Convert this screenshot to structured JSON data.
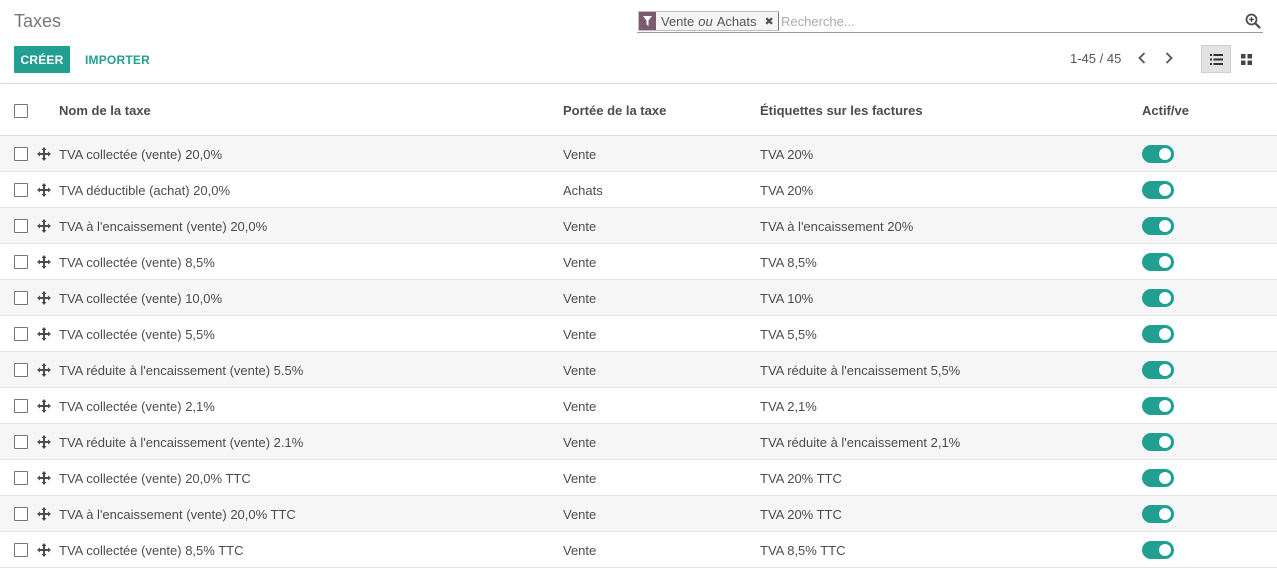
{
  "header": {
    "title": "Taxes",
    "create_label": "CRÉER",
    "import_label": "IMPORTER"
  },
  "search": {
    "facet_value_1": "Vente",
    "facet_separator": "ou",
    "facet_value_2": "Achats",
    "placeholder": "Recherche..."
  },
  "pager": {
    "range": "1-45 / 45"
  },
  "colors": {
    "primary": "#21a092",
    "facet_icon": "#7c5a70"
  },
  "columns": {
    "name": "Nom de la taxe",
    "scope": "Portée de la taxe",
    "tags": "Étiquettes sur les factures",
    "active": "Actif/ve"
  },
  "rows": [
    {
      "name": "TVA collectée (vente) 20,0%",
      "scope": "Vente",
      "tags": "TVA 20%",
      "active": true
    },
    {
      "name": "TVA déductible (achat) 20,0%",
      "scope": "Achats",
      "tags": "TVA 20%",
      "active": true
    },
    {
      "name": "TVA à l'encaissement (vente) 20,0%",
      "scope": "Vente",
      "tags": "TVA à l'encaissement 20%",
      "active": true
    },
    {
      "name": "TVA collectée (vente) 8,5%",
      "scope": "Vente",
      "tags": "TVA 8,5%",
      "active": true
    },
    {
      "name": "TVA collectée (vente) 10,0%",
      "scope": "Vente",
      "tags": "TVA 10%",
      "active": true
    },
    {
      "name": "TVA collectée (vente) 5,5%",
      "scope": "Vente",
      "tags": "TVA 5,5%",
      "active": true
    },
    {
      "name": "TVA réduite à l'encaissement (vente) 5.5%",
      "scope": "Vente",
      "tags": "TVA réduite à l'encaissement 5,5%",
      "active": true
    },
    {
      "name": "TVA collectée (vente) 2,1%",
      "scope": "Vente",
      "tags": "TVA 2,1%",
      "active": true
    },
    {
      "name": "TVA réduite à l'encaissement (vente) 2.1%",
      "scope": "Vente",
      "tags": "TVA réduite à l'encaissement 2,1%",
      "active": true
    },
    {
      "name": "TVA collectée (vente) 20,0% TTC",
      "scope": "Vente",
      "tags": "TVA 20% TTC",
      "active": true
    },
    {
      "name": "TVA à l'encaissement (vente) 20,0% TTC",
      "scope": "Vente",
      "tags": "TVA 20% TTC",
      "active": true
    },
    {
      "name": "TVA collectée (vente) 8,5% TTC",
      "scope": "Vente",
      "tags": "TVA 8,5% TTC",
      "active": true
    }
  ]
}
